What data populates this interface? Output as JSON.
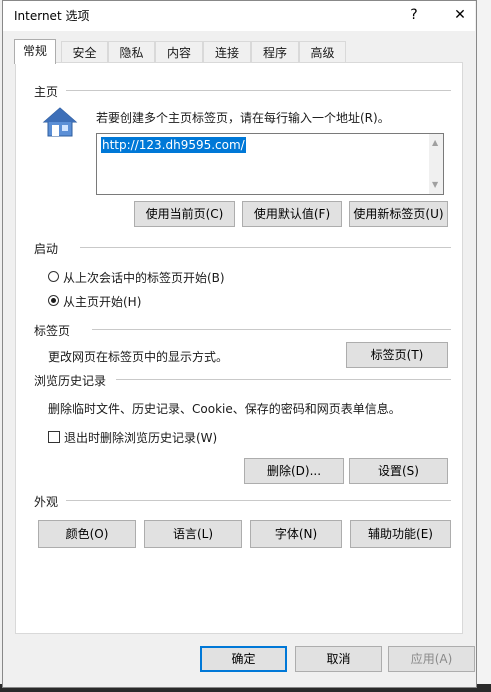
{
  "window": {
    "title": "Internet 选项",
    "help_label": "?",
    "close_label": "✕"
  },
  "tabs": [
    {
      "label": "常规",
      "active": true
    },
    {
      "label": "安全"
    },
    {
      "label": "隐私"
    },
    {
      "label": "内容"
    },
    {
      "label": "连接"
    },
    {
      "label": "程序"
    },
    {
      "label": "高级"
    }
  ],
  "homepage": {
    "section_title": "主页",
    "description": "若要创建多个主页标签页，请在每行输入一个地址(R)。",
    "url_value": "http://123.dh9595.com/",
    "icon": "house-icon",
    "buttons": {
      "use_current": "使用当前页(C)",
      "use_default": "使用默认值(F)",
      "use_new_tab": "使用新标签页(U)"
    }
  },
  "startup": {
    "section_title": "启动",
    "option_last_session": "从上次会话中的标签页开始(B)",
    "option_homepage": "从主页开始(H)",
    "selected": "homepage"
  },
  "tabs_section": {
    "section_title": "标签页",
    "description": "更改网页在标签页中的显示方式。",
    "button": "标签页(T)"
  },
  "history": {
    "section_title": "浏览历史记录",
    "description": "删除临时文件、历史记录、Cookie、保存的密码和网页表单信息。",
    "checkbox_label": "退出时删除浏览历史记录(W)",
    "checked": false,
    "delete_button": "删除(D)...",
    "settings_button": "设置(S)"
  },
  "appearance": {
    "section_title": "外观",
    "colors_button": "颜色(O)",
    "languages_button": "语言(L)",
    "fonts_button": "字体(N)",
    "accessibility_button": "辅助功能(E)"
  },
  "footer": {
    "ok_button": "确定",
    "cancel_button": "取消",
    "apply_button": "应用(A)"
  }
}
